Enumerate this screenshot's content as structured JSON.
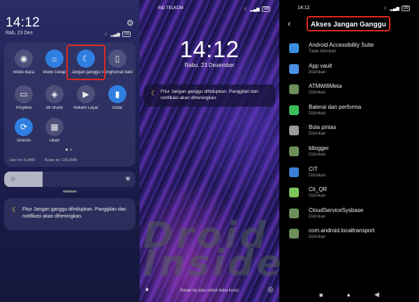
{
  "control_center": {
    "time": "14:12",
    "date": "Rab, 23 Des",
    "battery": "100",
    "tiles": [
      {
        "label": "Mode Baca",
        "icon": "eye-icon",
        "active": false
      },
      {
        "label": "Mode Gelap",
        "icon": "sun-icon",
        "active": true
      },
      {
        "label": "Jangan ganggu",
        "icon": "moon-icon",
        "active": true
      },
      {
        "label": "Penghemat baterai",
        "icon": "battery-icon",
        "active": false
      },
      {
        "label": "Proyeksi",
        "icon": "monitor-icon",
        "active": false
      },
      {
        "label": "Mi Share",
        "icon": "share-icon",
        "active": false
      },
      {
        "label": "Rekam Layar",
        "icon": "video-icon",
        "active": false
      },
      {
        "label": "Getar",
        "icon": "vibrate-icon",
        "active": true
      },
      {
        "label": "Sinkron",
        "icon": "sync-icon",
        "active": true
      },
      {
        "label": "Ubah",
        "icon": "grid-icon",
        "active": false
      }
    ],
    "usage_today": "Hari ini: 8,3MB",
    "usage_month": "Bulan ini: 126,5MB",
    "brightness_level": 0.29,
    "notification": "Fitur Jangan ganggu dihidupkan. Panggilan dan notifikasi akan diheningkan."
  },
  "lockscreen": {
    "carrier": "IND TELKOM",
    "battery": "100",
    "time": "14:12",
    "date": "Rabu, 23 Desember",
    "notification": "Fitur Jangan ganggu dihidupkan. Panggilan dan notifikasi akan diheningkan.",
    "swipe_hint": "Geser ke atas untuk buka kunci"
  },
  "dnd_access": {
    "time": "14:12",
    "battery": "100",
    "title": "Akses Jangan Ganggu",
    "apps": [
      {
        "name": "Android Accessibility Suite",
        "status": "Tidak diizinkan",
        "color": "#3b8ee0"
      },
      {
        "name": "App vault",
        "status": "Diizinkan",
        "color": "#4a90e2"
      },
      {
        "name": "ATMWifiMeta",
        "status": "Diizinkan",
        "color": "#6c8f5a"
      },
      {
        "name": "Baterai dan performa",
        "status": "Diizinkan",
        "color": "#3cbf5a"
      },
      {
        "name": "Bola pintas",
        "status": "Diizinkan",
        "color": "#9a9a9a"
      },
      {
        "name": "btlogger",
        "status": "Diizinkan",
        "color": "#6c8f5a"
      },
      {
        "name": "CIT",
        "status": "Diizinkan",
        "color": "#3b7fd6"
      },
      {
        "name": "Cit_QR",
        "status": "Diizinkan",
        "color": "#7bc35a"
      },
      {
        "name": "CloudServiceSysbase",
        "status": "Diizinkan",
        "color": "#6c8f5a"
      },
      {
        "name": "com.android.localtransport",
        "status": "Diizinkan",
        "color": "#6c8f5a"
      }
    ]
  },
  "watermark": [
    "Droid",
    "Inside"
  ],
  "colors": {
    "highlight": "#e0281f",
    "accent": "#2f7fe0",
    "moon": "#f2c040"
  }
}
